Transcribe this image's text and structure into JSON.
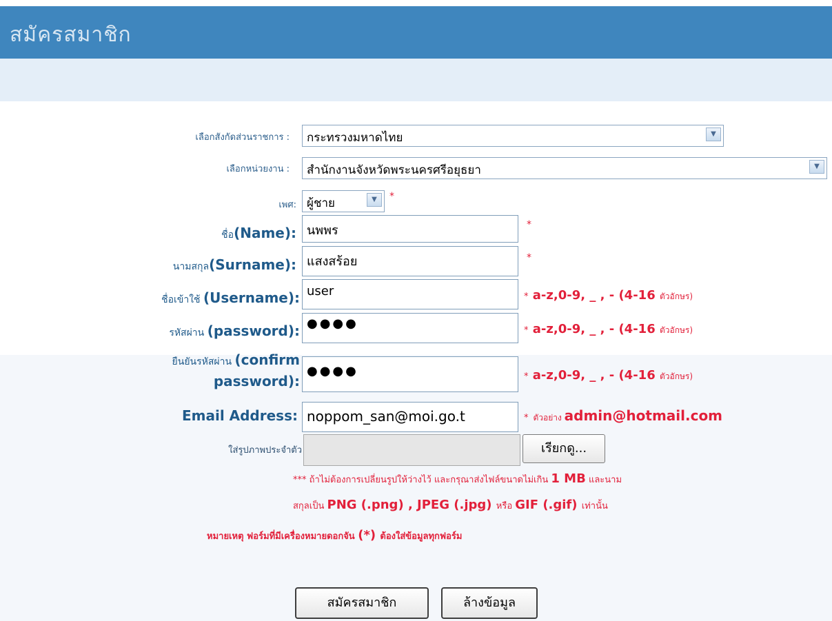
{
  "header": {
    "title": "สมัครสมาชิก"
  },
  "form": {
    "agency_label": "เลือกสังกัดส่วนราชการ :",
    "agency_value": "กระทรวงมหาดไทย",
    "unit_label": "เลือกหน่วยงาน :",
    "unit_value": "สำนักงานจังหวัดพระนครศรีอยุธยา",
    "gender_label": "เพศ:",
    "gender_value": "ผู้ชาย",
    "name_label_th": "ชื่อ",
    "name_label_en": "(Name):",
    "name_value": "นพพร",
    "surname_label_th": "นามสกุล",
    "surname_label_en": "(Surname):",
    "surname_value": "แสงสร้อย",
    "username_label_th": "ชื่อเข้าใช้ ",
    "username_label_en": "(Username):",
    "username_value": "user",
    "username_hint": "a-z,0-9, _ , - (4-16 ",
    "username_hint_small": "ตัวอักษร)",
    "password_label_th": "รหัสผ่าน ",
    "password_label_en": "(password):",
    "password_value": "●●●●",
    "password_hint": "a-z,0-9, _ , - (4-16 ",
    "password_hint_small": "ตัวอักษร)",
    "confirm_label_th": "ยืนยันรหัสผ่าน ",
    "confirm_label_en1": "(confirm",
    "confirm_label_en2": "password):",
    "confirm_value": "●●●●",
    "confirm_hint": "a-z,0-9, _ , - (4-16 ",
    "confirm_hint_small": "ตัวอักษร)",
    "email_label": "Email Address:",
    "email_value": "noppom_san@moi.go.t",
    "email_hint_small": "ตัวอย่าง ",
    "email_hint": "admin@hotmail.com",
    "photo_label": "ใส่รูปภาพประจำตัว",
    "browse_button": "เรียกดู...",
    "required_star": "*",
    "photo_note1_a": "*** ถ้าไม่ต้องการเปลี่ยนรูปให้ว่างไว้ และกรุณาส่งไฟล์ขนาดไม่เกิน ",
    "photo_note1_b": "1 MB",
    "photo_note1_c": " และนามสกุลเป็น",
    "photo_note2_a": "สกุลเป็น ",
    "photo_note2_b": "PNG (.png) , JPEG (.jpg) ",
    "photo_note2_c": "หรือ ",
    "photo_note2_d": "GIF (.gif) ",
    "photo_note2_e": "เท่านั้น",
    "remark_a": "หมายเหตุ ฟอร์มที่มีเครื่องหมายดอกจัน ",
    "remark_b": "(*) ",
    "remark_c": "ต้องใส่ข้อมูลทุกฟอร์ม"
  },
  "buttons": {
    "submit": "สมัครสมาชิก",
    "reset": "ล้างข้อมูล"
  }
}
